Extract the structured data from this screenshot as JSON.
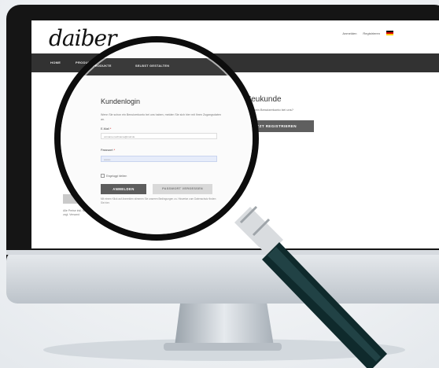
{
  "site": {
    "logo": "daiber",
    "toplinks": {
      "login": "Anmelden",
      "register": "Registrieren"
    },
    "nav": [
      "HOME",
      "PRODUKTE",
      "SELBST GESTALTEN"
    ],
    "left_fragment": "Alle Preise inkl. MwSt. zzgl. Versand",
    "neukunde": {
      "title": "Neukunde",
      "text": "Noch kein Benutzerkonto bei uns?",
      "button": "JETZT REGISTRIEREN"
    }
  },
  "login": {
    "nav": [
      "HOME",
      "PRODUKTE",
      "SELBST GESTALTEN"
    ],
    "title": "Kundenlogin",
    "intro": "Wenn Sie schon ein Benutzerkonto bei uns haben, melden Sie sich hier mit Ihren Zugangsdaten an.",
    "email_label": "E-Mail",
    "email_value": "vorname.nachname@mail.de",
    "password_label": "Passwort",
    "password_value": "••••••••",
    "remember_label": "Eingeloggt bleiben",
    "submit_button": "ANMELDEN",
    "forgot_button": "PASSWORT VERGESSEN",
    "note": "Mit einem Klick auf Anmelden stimmen Sie unseren Bedingungen zu. Hinweise zum Datenschutz finden Sie hier."
  },
  "colors": {
    "navbar": "#323232",
    "button_primary": "#5d5d5d",
    "monitor_bezel": "#151515",
    "magnifier_frame": "#0d0d0d",
    "magnifier_handle": "#0f2a2c"
  }
}
